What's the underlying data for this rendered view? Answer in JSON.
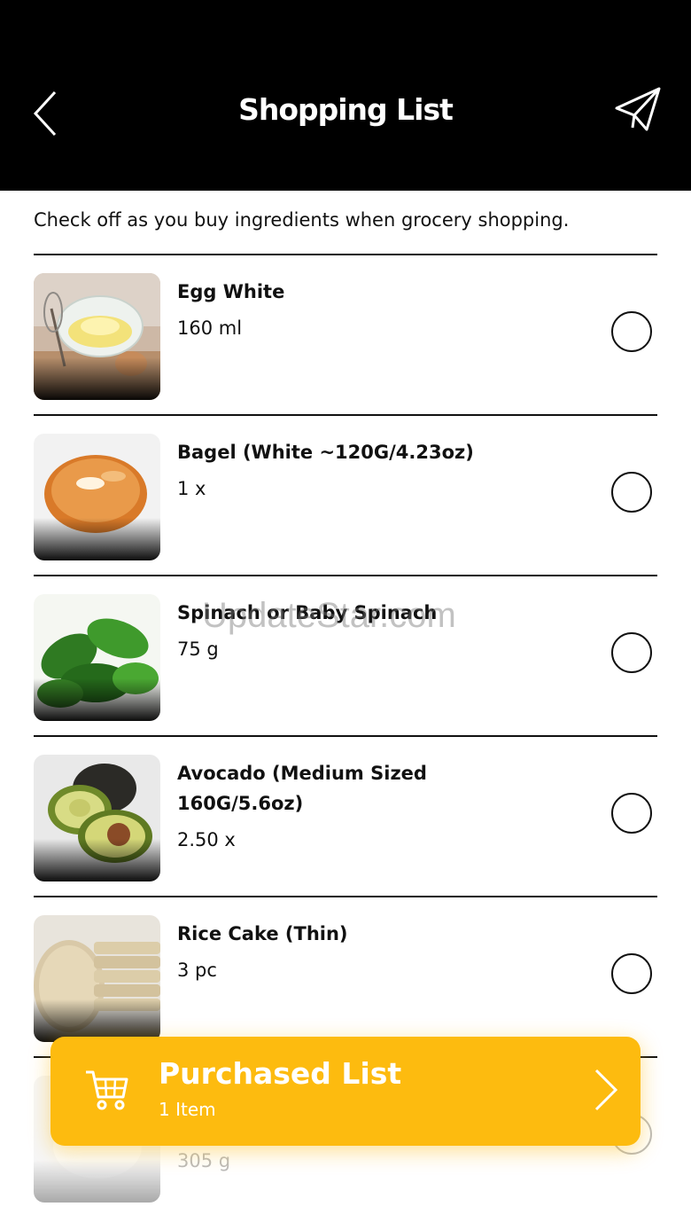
{
  "header": {
    "title": "Shopping List",
    "background": "#000000"
  },
  "subtitle": "Check off as you buy ingredients when grocery shopping.",
  "items": [
    {
      "name": "Egg White",
      "quantity": "160 ml",
      "checked": false,
      "thumb_icon": "egg-white-photo"
    },
    {
      "name": "Bagel (White ~120G/4.23oz)",
      "quantity": "1 x",
      "checked": false,
      "thumb_icon": "bagel-photo"
    },
    {
      "name": "Spinach or Baby Spinach",
      "quantity": "75 g",
      "checked": false,
      "thumb_icon": "spinach-photo"
    },
    {
      "name": "Avocado (Medium Sized 160G/5.6oz)",
      "quantity": "2.50 x",
      "checked": false,
      "thumb_icon": "avocado-photo"
    },
    {
      "name": "Rice Cake (Thin)",
      "quantity": "3 pc",
      "checked": false,
      "thumb_icon": "rice-cake-photo"
    },
    {
      "name": "",
      "quantity": "305 g",
      "checked": false,
      "thumb_icon": "food-photo"
    }
  ],
  "watermark": "UpdateStar.com",
  "purchased": {
    "title": "Purchased List",
    "count": "1 Item",
    "accent": "#FDBB0F"
  }
}
